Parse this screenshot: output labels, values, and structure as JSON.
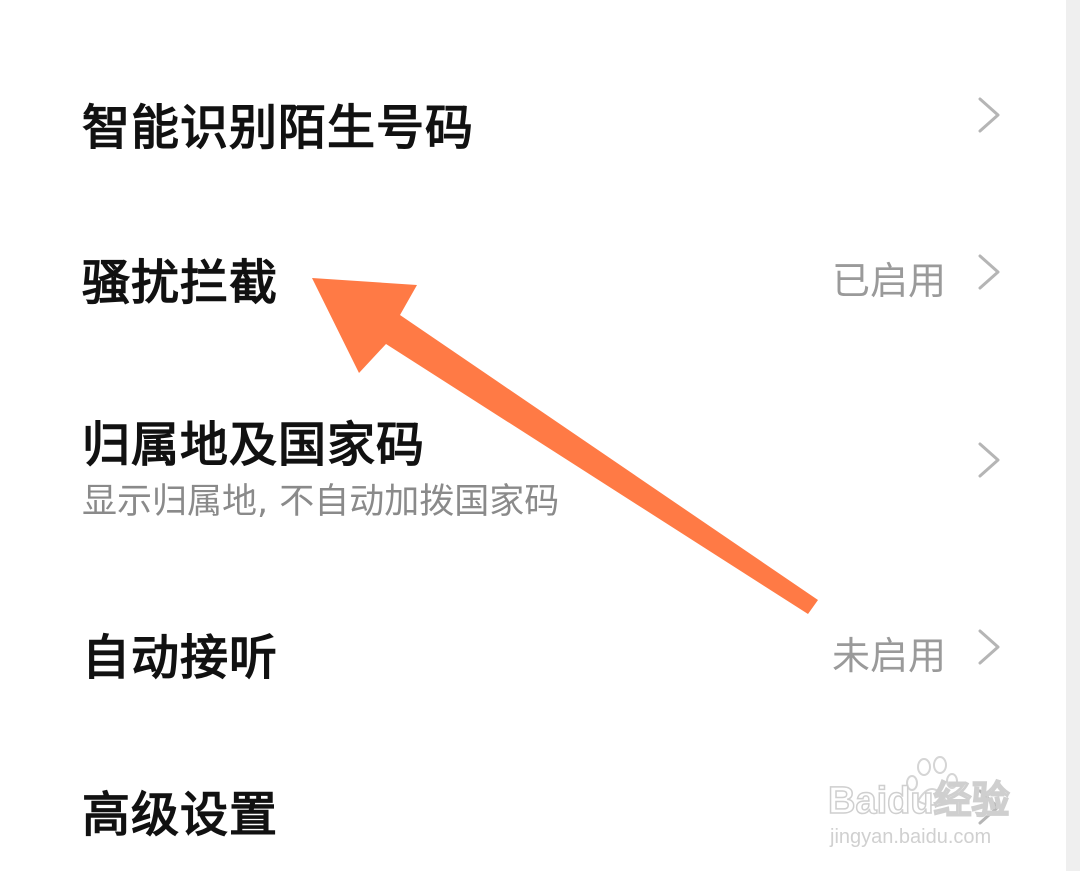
{
  "settings": {
    "items": [
      {
        "title": "智能识别陌生号码",
        "status": "",
        "subtitle": ""
      },
      {
        "title": "骚扰拦截",
        "status": "已启用",
        "subtitle": ""
      },
      {
        "title": "归属地及国家码",
        "status": "",
        "subtitle": "显示归属地, 不自动加拨国家码"
      },
      {
        "title": "自动接听",
        "status": "未启用",
        "subtitle": ""
      },
      {
        "title": "高级设置",
        "status": "",
        "subtitle": ""
      }
    ]
  },
  "annotation": {
    "arrow_color": "#FF7A45"
  },
  "watermark": {
    "brand_text": "Baidu经验",
    "url_text": "jingyan.baidu.com"
  },
  "icons": {
    "chevron": "chevron-right-icon"
  }
}
